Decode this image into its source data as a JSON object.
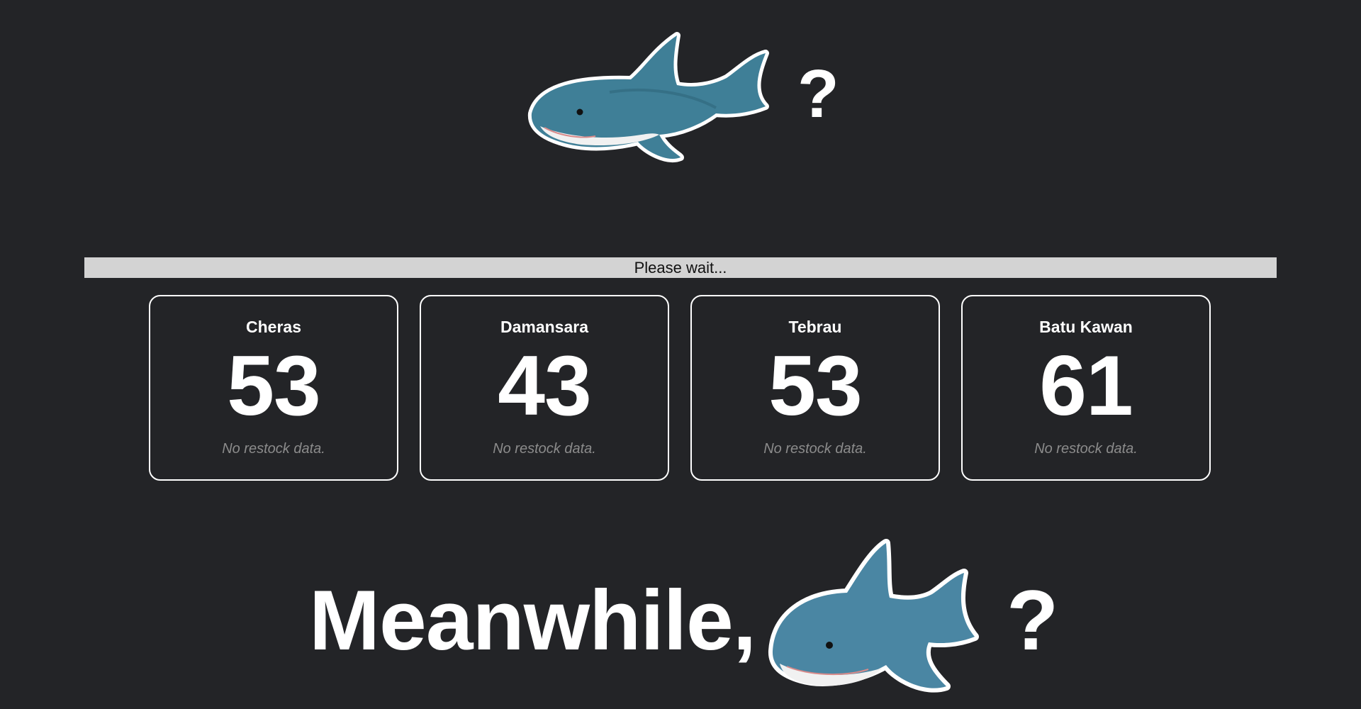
{
  "header": {
    "image_icon": "blahaj-shark-plush-icon",
    "question_mark": "?"
  },
  "status": {
    "text": "Please wait..."
  },
  "stores": [
    {
      "name": "Cheras",
      "count": "53",
      "note": "No restock data."
    },
    {
      "name": "Damansara",
      "count": "43",
      "note": "No restock data."
    },
    {
      "name": "Tebrau",
      "count": "53",
      "note": "No restock data."
    },
    {
      "name": "Batu Kawan",
      "count": "61",
      "note": "No restock data."
    }
  ],
  "footer": {
    "heading": "Meanwhile,",
    "image_icon": "blahaj-shark-plush-icon",
    "question_mark": "?"
  },
  "colors": {
    "background": "#232427",
    "card_border": "#ffffff",
    "status_bar": "#d3d3d3",
    "shark_body": "#3f7f97",
    "shark_belly": "#f1f1f1"
  }
}
